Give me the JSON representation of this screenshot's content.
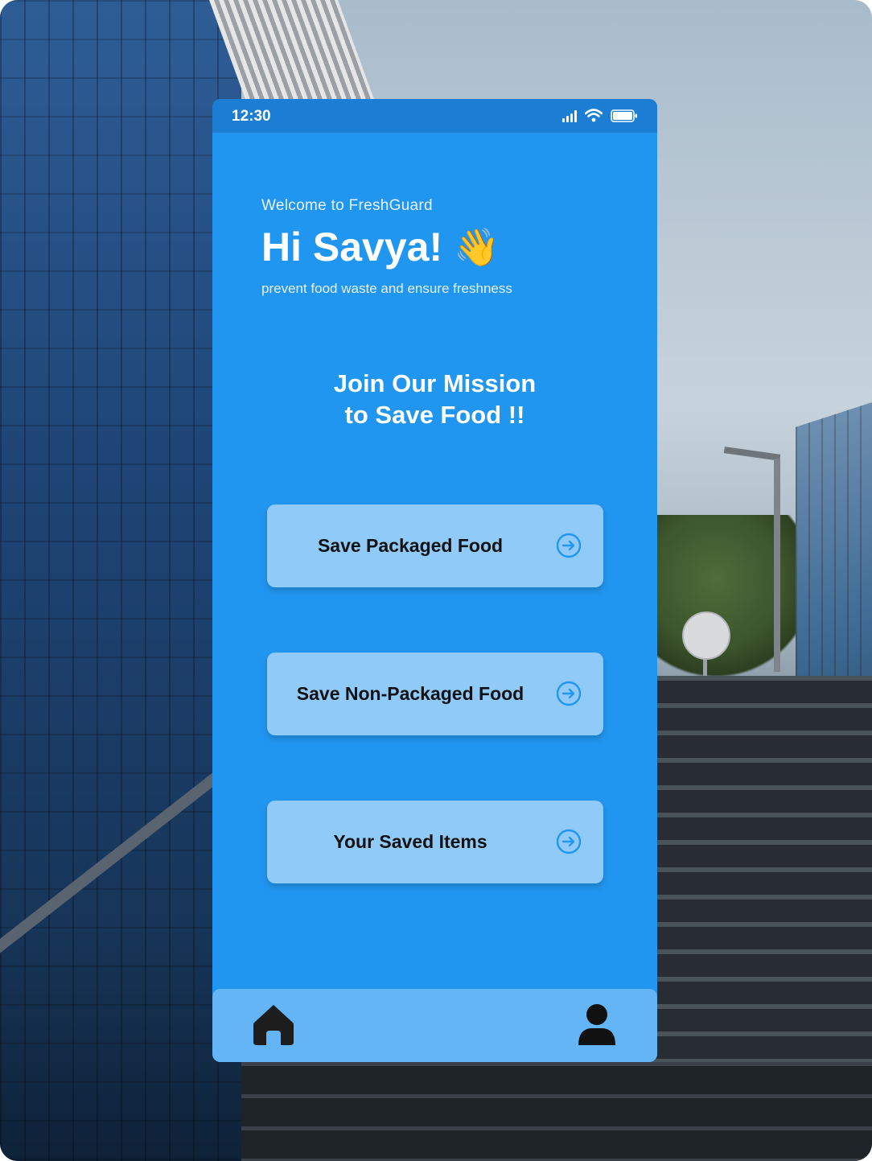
{
  "status_bar": {
    "time": "12:30",
    "icons": [
      "cellular-signal-icon",
      "wifi-icon",
      "battery-icon"
    ]
  },
  "header": {
    "welcome": "Welcome to FreshGuard",
    "greeting": "Hi Savya!",
    "greeting_emoji": "👋",
    "tagline": "prevent food waste and ensure freshness"
  },
  "mission": {
    "line1": "Join Our Mission",
    "line2": "to Save Food !!"
  },
  "actions": [
    {
      "label": "Save Packaged Food",
      "icon": "arrow-right-circle-icon"
    },
    {
      "label": "Save Non-Packaged Food",
      "icon": "arrow-right-circle-icon"
    },
    {
      "label": "Your Saved Items",
      "icon": "arrow-right-circle-icon"
    }
  ],
  "bottom_nav": {
    "items": [
      "home-icon",
      "profile-icon"
    ]
  },
  "colors": {
    "primary": "#2196f0",
    "status_bar": "#1b7ed4",
    "button_bg": "#90caf9",
    "nav_bg": "#64b5f6",
    "icon_accent": "#2196f3"
  }
}
